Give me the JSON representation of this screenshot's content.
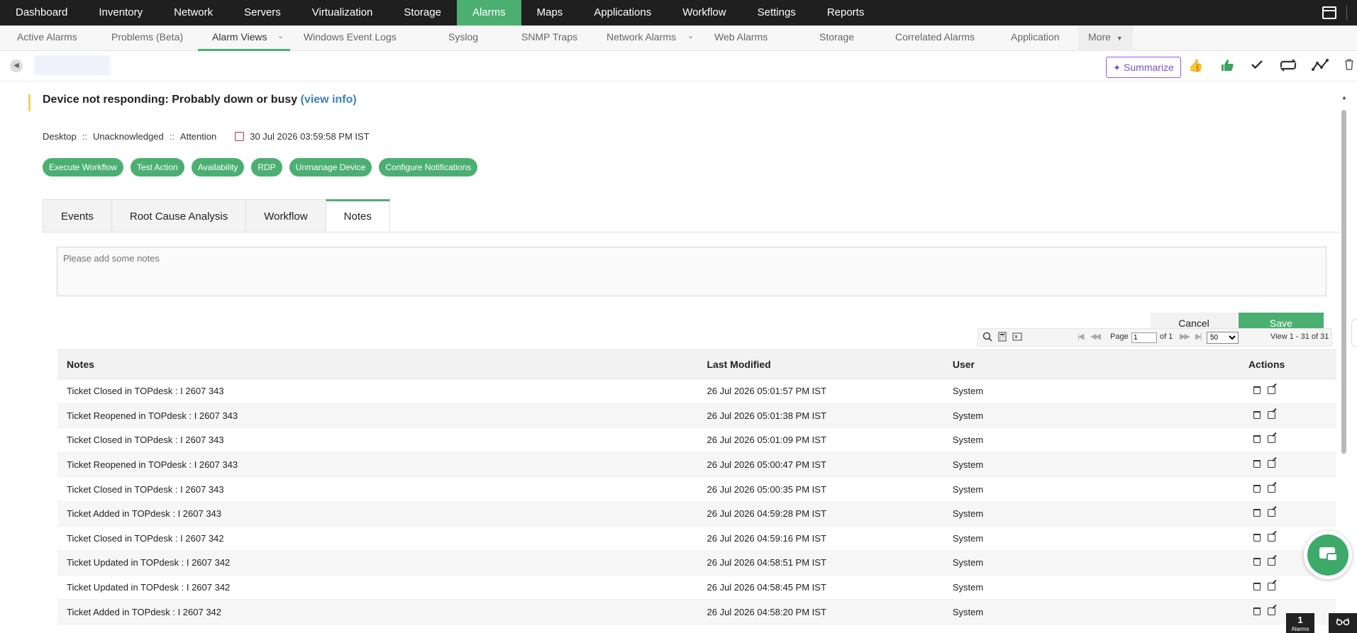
{
  "topnav": {
    "items": [
      "Dashboard",
      "Inventory",
      "Network",
      "Servers",
      "Virtualization",
      "Storage",
      "Alarms",
      "Maps",
      "Applications",
      "Workflow",
      "Settings",
      "Reports"
    ],
    "active": "Alarms"
  },
  "subnav": {
    "items": [
      "Active Alarms",
      "Problems (Beta)",
      "Alarm Views",
      "Windows Event Logs",
      "Syslog",
      "SNMP Traps",
      "Network Alarms",
      "Web Alarms",
      "Storage",
      "Correlated Alarms",
      "Application",
      "More"
    ],
    "active": "Alarm Views"
  },
  "toolbar": {
    "summarize_label": "Summarize"
  },
  "alarm": {
    "title": "Device not responding: Probably down or busy",
    "view_info": "(view info)",
    "category": "Desktop",
    "status": "Unacknowledged",
    "severity": "Attention",
    "separator": "::",
    "timestamp": "30 Jul 2026 03:59:58 PM IST"
  },
  "actions": [
    "Execute Workflow",
    "Test Action",
    "Availability",
    "RDP",
    "Unmanage Device",
    "Configure Notifications"
  ],
  "tabs": [
    "Events",
    "Root Cause Analysis",
    "Workflow",
    "Notes"
  ],
  "active_tab": "Notes",
  "notes_form": {
    "placeholder": "Please add some notes",
    "cancel_label": "Cancel",
    "save_label": "Save"
  },
  "grid": {
    "page_label": "Page",
    "page_value": "1",
    "of_label": "of 1",
    "page_size": "50",
    "view_label": "View 1 - 31 of 31"
  },
  "table": {
    "headers": [
      "Notes",
      "Last Modified",
      "User",
      "Actions"
    ],
    "rows": [
      {
        "note": "Ticket Closed in TOPdesk : I 2607 343",
        "modified": "26 Jul 2026 05:01:57 PM IST",
        "user": "System"
      },
      {
        "note": "Ticket Reopened in TOPdesk : I 2607 343",
        "modified": "26 Jul 2026 05:01:38 PM IST",
        "user": "System"
      },
      {
        "note": "Ticket Closed in TOPdesk : I 2607 343",
        "modified": "26 Jul 2026 05:01:09 PM IST",
        "user": "System"
      },
      {
        "note": "Ticket Reopened in TOPdesk : I 2607 343",
        "modified": "26 Jul 2026 05:00:47 PM IST",
        "user": "System"
      },
      {
        "note": "Ticket Closed in TOPdesk : I 2607 343",
        "modified": "26 Jul 2026 05:00:35 PM IST",
        "user": "System"
      },
      {
        "note": "Ticket Added in TOPdesk : I 2607 343",
        "modified": "26 Jul 2026 04:59:28 PM IST",
        "user": "System"
      },
      {
        "note": "Ticket Closed in TOPdesk : I 2607 342",
        "modified": "26 Jul 2026 04:59:16 PM IST",
        "user": "System"
      },
      {
        "note": "Ticket Updated in TOPdesk : I 2607 342",
        "modified": "26 Jul 2026 04:58:51 PM IST",
        "user": "System"
      },
      {
        "note": "Ticket Updated in TOPdesk : I 2607 342",
        "modified": "26 Jul 2026 04:58:45 PM IST",
        "user": "System"
      },
      {
        "note": "Ticket Added in TOPdesk : I 2607 342",
        "modified": "26 Jul 2026 04:58:20 PM IST",
        "user": "System"
      }
    ]
  },
  "footer": {
    "alarm_count": "1",
    "alarm_label": "Alarms"
  },
  "colors": {
    "accent": "#4caf72",
    "nav_bg": "#1f1f1f",
    "link": "#3b82c4",
    "summarize": "#7c4ddc"
  }
}
